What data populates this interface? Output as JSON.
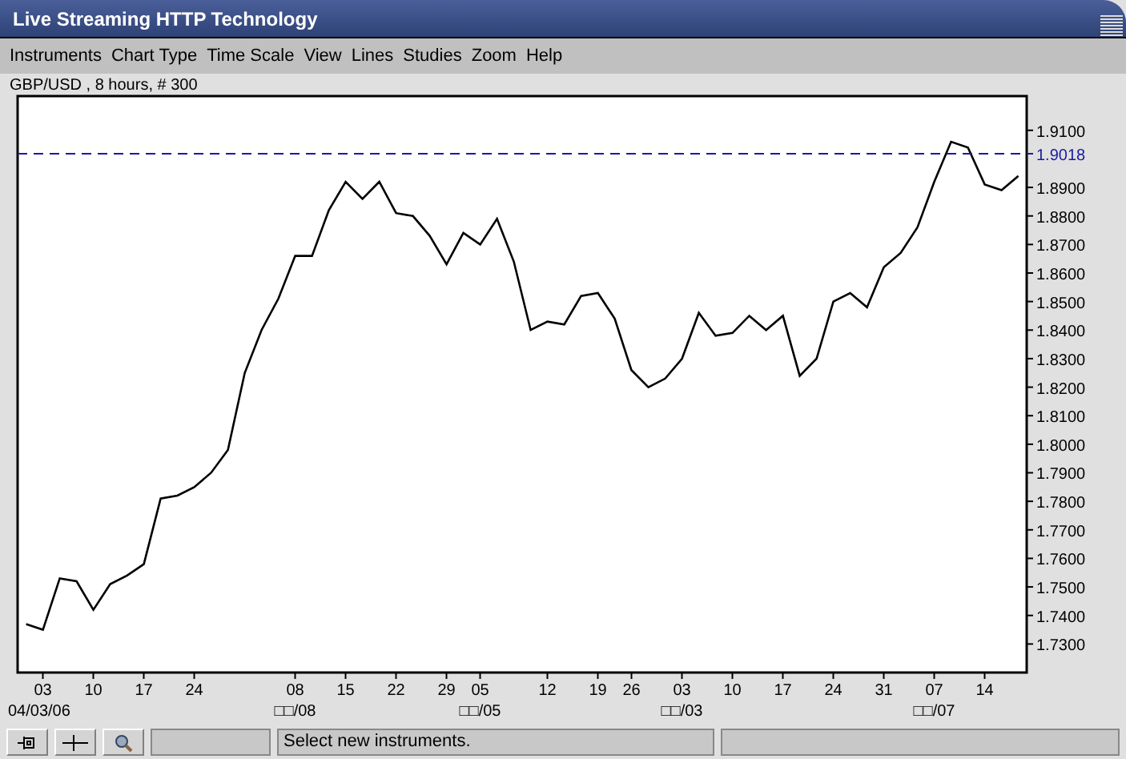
{
  "window": {
    "title": "Live Streaming HTTP Technology"
  },
  "menu": [
    "Instruments",
    "Chart Type",
    "Time Scale",
    "View",
    "Lines",
    "Studies",
    "Zoom",
    "Help"
  ],
  "chart": {
    "caption": "GBP/USD , 8 hours, # 300",
    "month_labels": [
      "04/03/06",
      "□□/08",
      "□□/05",
      "□□/03",
      "□□/07"
    ],
    "chart_data": {
      "type": "line",
      "ylim": [
        1.72,
        1.922
      ],
      "categories": [
        null,
        "03",
        null,
        null,
        "10",
        null,
        null,
        "17",
        null,
        null,
        "24",
        null,
        null,
        null,
        null,
        null,
        "08",
        null,
        null,
        "15",
        null,
        null,
        "22",
        null,
        null,
        "29",
        null,
        "05",
        null,
        null,
        null,
        "12",
        null,
        null,
        "19",
        null,
        "26",
        null,
        null,
        "03",
        null,
        null,
        "10",
        null,
        null,
        "17",
        null,
        null,
        "24",
        null,
        null,
        "31",
        null,
        null,
        "07",
        null,
        null,
        "14",
        null,
        null
      ],
      "values": [
        1.737,
        1.735,
        1.753,
        1.752,
        1.742,
        1.751,
        1.754,
        1.758,
        1.781,
        1.782,
        1.785,
        1.79,
        1.798,
        1.825,
        1.84,
        1.851,
        1.866,
        1.866,
        1.882,
        1.892,
        1.886,
        1.892,
        1.881,
        1.88,
        1.873,
        1.863,
        1.874,
        1.87,
        1.879,
        1.864,
        1.84,
        1.843,
        1.842,
        1.852,
        1.853,
        1.844,
        1.826,
        1.82,
        1.823,
        1.83,
        1.846,
        1.838,
        1.839,
        1.845,
        1.84,
        1.845,
        1.824,
        1.83,
        1.85,
        1.853,
        1.848,
        1.862,
        1.867,
        1.876,
        1.892,
        1.906,
        1.904,
        1.891,
        1.889,
        1.894
      ],
      "yticks": [
        {
          "value": 1.73,
          "label": "1.7300"
        },
        {
          "value": 1.74,
          "label": "1.7400"
        },
        {
          "value": 1.75,
          "label": "1.7500"
        },
        {
          "value": 1.76,
          "label": "1.7600"
        },
        {
          "value": 1.77,
          "label": "1.7700"
        },
        {
          "value": 1.78,
          "label": "1.7800"
        },
        {
          "value": 1.79,
          "label": "1.7900"
        },
        {
          "value": 1.8,
          "label": "1.8000"
        },
        {
          "value": 1.81,
          "label": "1.8100"
        },
        {
          "value": 1.82,
          "label": "1.8200"
        },
        {
          "value": 1.83,
          "label": "1.8300"
        },
        {
          "value": 1.84,
          "label": "1.8400"
        },
        {
          "value": 1.85,
          "label": "1.8500"
        },
        {
          "value": 1.86,
          "label": "1.8600"
        },
        {
          "value": 1.87,
          "label": "1.8700"
        },
        {
          "value": 1.88,
          "label": "1.8800"
        },
        {
          "value": 1.89,
          "label": "1.8900"
        },
        {
          "value": 1.91,
          "label": "1.9100"
        }
      ],
      "ref_lines": [
        {
          "axis": "y",
          "value": 1.9018,
          "label": "1.9018"
        }
      ]
    }
  },
  "status_bar": {
    "message": "Select new instruments."
  }
}
